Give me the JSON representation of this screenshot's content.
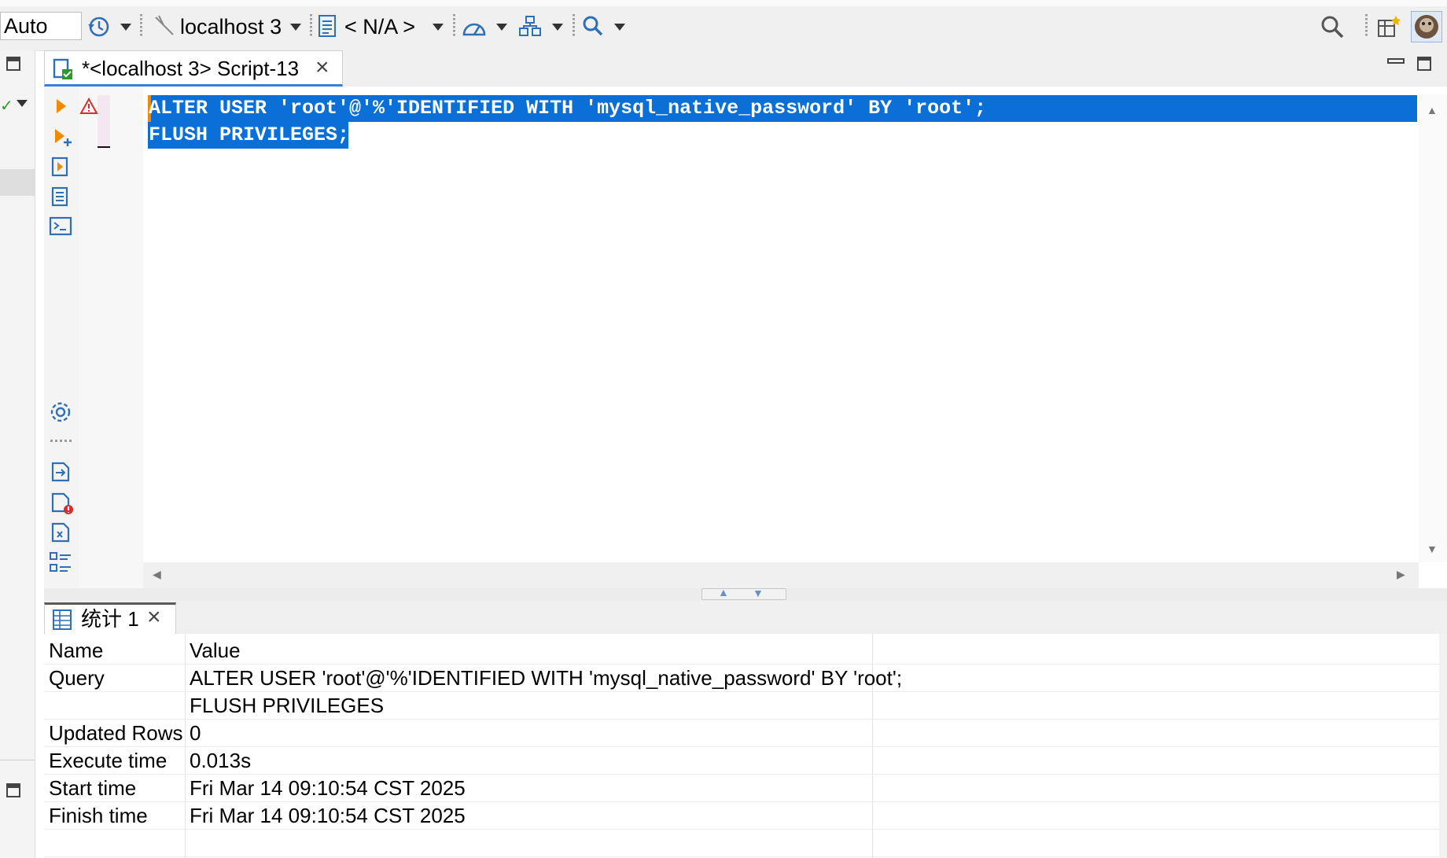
{
  "toolbar": {
    "commit_mode": "Auto",
    "datasource": "localhost 3",
    "schema": "< N/A >"
  },
  "editor": {
    "tab_title": "*<localhost 3> Script-13",
    "lines": [
      "ALTER USER 'root'@'%'IDENTIFIED WITH 'mysql_native_password' BY 'root';",
      "FLUSH PRIVILEGES;"
    ]
  },
  "results": {
    "tab_title": "统计 1",
    "columns": [
      "Name",
      "Value"
    ],
    "rows": [
      {
        "name": "Query",
        "value": "ALTER USER 'root'@'%'IDENTIFIED WITH 'mysql_native_password' BY 'root';"
      },
      {
        "name": "",
        "value": "FLUSH PRIVILEGES"
      },
      {
        "name": "Updated Rows",
        "value": "0"
      },
      {
        "name": "Execute time",
        "value": "0.013s"
      },
      {
        "name": "Start time",
        "value": "Fri Mar 14 09:10:54 CST 2025"
      },
      {
        "name": "Finish time",
        "value": "Fri Mar 14 09:10:54 CST 2025"
      }
    ]
  },
  "colors": {
    "selection": "#0a6fd6",
    "accent": "#3c7fd6",
    "icon_blue": "#2f6fb6",
    "warning_red": "#d32f2f",
    "run_orange": "#f08a00"
  }
}
